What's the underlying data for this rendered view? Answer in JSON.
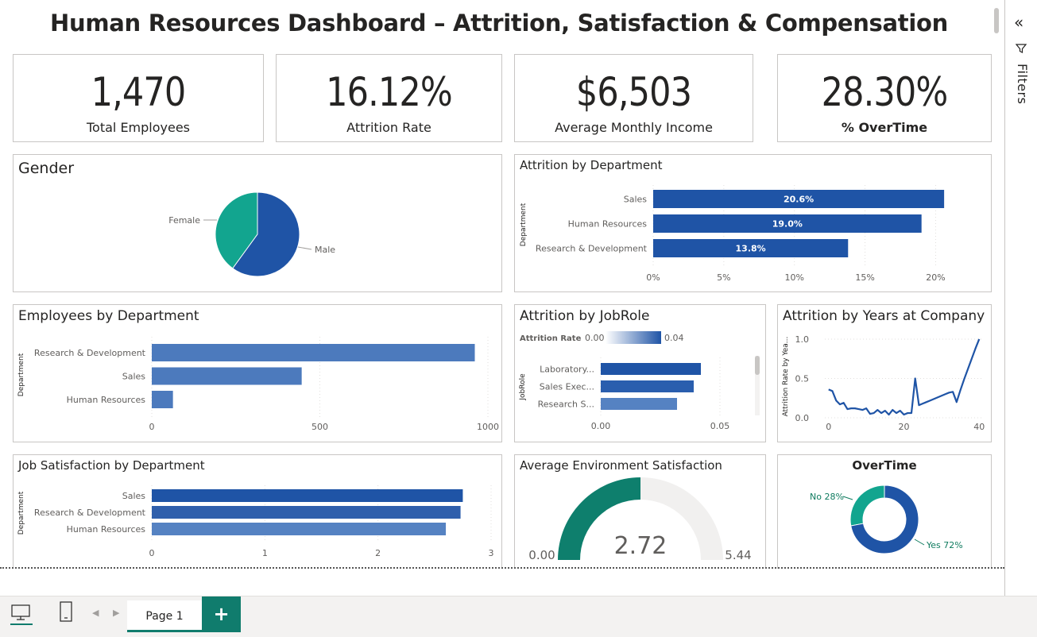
{
  "dashboard": {
    "title": "Human Resources Dashboard – Attrition, Satisfaction & Compensation"
  },
  "kpis": [
    {
      "value": "1,470",
      "label": "Total Employees"
    },
    {
      "value": "16.12%",
      "label": "Attrition Rate"
    },
    {
      "value": "$6,503",
      "label": "Average Monthly Income"
    },
    {
      "value": "28.30%",
      "label": "% OverTime"
    }
  ],
  "visuals": {
    "gender": {
      "title": "Gender"
    },
    "attrition_dept": {
      "title": "Attrition by Department",
      "axis_title": "Department"
    },
    "employees_dept": {
      "title": "Employees by Department",
      "axis_title": "Department"
    },
    "attrition_jobrole": {
      "title": "Attrition by JobRole",
      "axis_title": "JobRole",
      "legend_title": "Attrition Rate",
      "legend_min": "0.00",
      "legend_max": "0.04"
    },
    "attrition_years": {
      "title": "Attrition by Years at Company",
      "axis_title": "Attrition Rate by Yea..."
    },
    "jobsat_dept": {
      "title": "Job Satisfaction by Department",
      "axis_title": "Department"
    },
    "env_sat": {
      "title": "Average Environment Satisfaction"
    },
    "overtime": {
      "title": "OverTime"
    }
  },
  "chart_data": [
    {
      "id": "gender",
      "type": "pie",
      "labels": [
        "Female",
        "Male"
      ],
      "values": [
        40,
        60
      ],
      "colors": [
        "#12a58f",
        "#1f54a6"
      ]
    },
    {
      "id": "attrition_dept",
      "type": "bar",
      "categories": [
        "Sales",
        "Human Resources",
        "Research & Development"
      ],
      "values": [
        20.6,
        19.0,
        13.8
      ],
      "data_labels": [
        "20.6%",
        "19.0%",
        "13.8%"
      ],
      "xlim": [
        0,
        22
      ],
      "xticks": [
        0,
        5,
        10,
        15,
        20
      ],
      "xtick_labels": [
        "0%",
        "5%",
        "10%",
        "15%",
        "20%"
      ],
      "ylabel": "Department",
      "color": "#1f54a6"
    },
    {
      "id": "employees_dept",
      "type": "bar",
      "categories": [
        "Research & Development",
        "Sales",
        "Human Resources"
      ],
      "values": [
        961,
        446,
        63
      ],
      "xlim": [
        0,
        1000
      ],
      "xticks": [
        0,
        500,
        1000
      ],
      "xtick_labels": [
        "0",
        "500",
        "1000"
      ],
      "ylabel": "Department",
      "color": "#4c7abd"
    },
    {
      "id": "attrition_jobrole",
      "type": "bar",
      "categories": [
        "Laboratory...",
        "Sales Exec...",
        "Research S..."
      ],
      "values": [
        0.042,
        0.039,
        0.032
      ],
      "xlim": [
        0,
        0.06
      ],
      "xticks": [
        0,
        0.05
      ],
      "xtick_labels": [
        "0.00",
        "0.05"
      ],
      "ylabel": "JobRole",
      "colors": [
        "#1f54a6",
        "#2a5eae",
        "#5582c2"
      ]
    },
    {
      "id": "attrition_years",
      "type": "line",
      "x": [
        0,
        1,
        2,
        3,
        4,
        5,
        6,
        7,
        8,
        9,
        10,
        11,
        12,
        13,
        14,
        15,
        16,
        17,
        18,
        19,
        20,
        21,
        22,
        23,
        24,
        25,
        26,
        27,
        28,
        29,
        30,
        31,
        32,
        33,
        34,
        35,
        36,
        37,
        38,
        39,
        40
      ],
      "y": [
        0.36,
        0.34,
        0.22,
        0.17,
        0.19,
        0.11,
        0.12,
        0.12,
        0.11,
        0.1,
        0.12,
        0.05,
        0.06,
        0.1,
        0.06,
        0.09,
        0.04,
        0.1,
        0.06,
        0.09,
        0.04,
        0.06,
        0.06,
        0.5,
        0.16,
        0.18,
        0.2,
        0.22,
        0.24,
        0.26,
        0.28,
        0.3,
        0.32,
        0.33,
        0.2,
        0.35,
        0.49,
        0.62,
        0.75,
        0.88,
        1.0
      ],
      "xlim": [
        -1,
        41
      ],
      "ylim": [
        0,
        1.05
      ],
      "xticks": [
        0,
        20,
        40
      ],
      "yticks": [
        0.0,
        0.5,
        1.0
      ],
      "ytick_labels": [
        "0.0",
        "0.5",
        "1.0"
      ],
      "ylabel": "Attrition Rate by Yea...",
      "color": "#1f54a6"
    },
    {
      "id": "jobsat_dept",
      "type": "bar",
      "categories": [
        "Sales",
        "Research & Development",
        "Human Resources"
      ],
      "values": [
        2.75,
        2.73,
        2.6
      ],
      "xlim": [
        0,
        3
      ],
      "xticks": [
        0,
        1,
        2,
        3
      ],
      "xtick_labels": [
        "0",
        "1",
        "2",
        "3"
      ],
      "ylabel": "Department",
      "colors": [
        "#1f54a6",
        "#2f5fac",
        "#5582c2"
      ]
    },
    {
      "id": "env_sat",
      "type": "gauge",
      "value": 2.72,
      "value_label": "2.72",
      "min": 0,
      "max": 5.44,
      "min_label": "0.00",
      "max_label": "5.44",
      "fill_color": "#0e7f6d",
      "track_color": "#f1f0ef"
    },
    {
      "id": "overtime",
      "type": "pie",
      "labels": [
        "No",
        "Yes"
      ],
      "data_labels": [
        "No 28%",
        "Yes 72%"
      ],
      "values": [
        28,
        72
      ],
      "colors": [
        "#12a58f",
        "#1f54a6"
      ]
    }
  ],
  "filter_pane": {
    "label": "Filters"
  },
  "pages": {
    "current": "Page 1",
    "add_label": "+"
  }
}
